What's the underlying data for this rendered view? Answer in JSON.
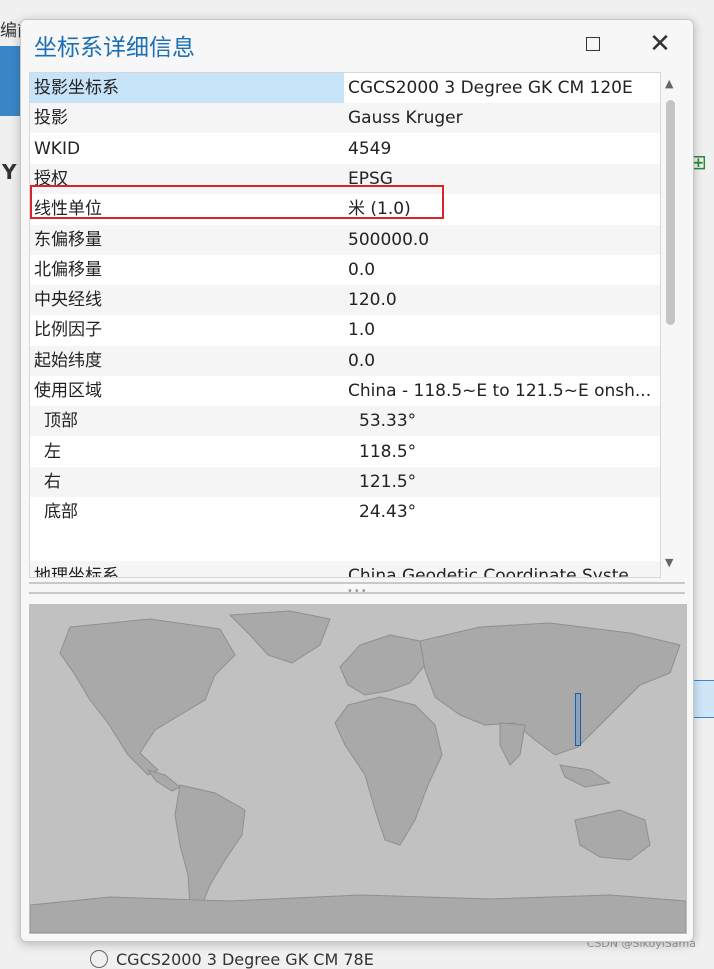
{
  "background": {
    "top_left_fragment": "编前",
    "left_fragment": "Y",
    "bottom_item": "CGCS2000 3 Degree GK CM 78E",
    "watermark": "CSDN @SikoyiSama"
  },
  "dialog": {
    "title": "坐标系详细信息",
    "maximize_icon": "maximize-icon",
    "close_icon": "close-icon"
  },
  "properties": [
    {
      "key": "投影坐标系",
      "value": "CGCS2000 3 Degree GK CM 120E",
      "selected": true
    },
    {
      "key": "投影",
      "value": "Gauss Kruger"
    },
    {
      "key": "WKID",
      "value": "4549",
      "highlighted": true
    },
    {
      "key": "授权",
      "value": "EPSG"
    },
    {
      "key": "线性单位",
      "value": "米 (1.0)"
    },
    {
      "key": "东偏移量",
      "value": "500000.0"
    },
    {
      "key": "北偏移量",
      "value": "0.0"
    },
    {
      "key": "中央经线",
      "value": "120.0"
    },
    {
      "key": "比例因子",
      "value": "1.0"
    },
    {
      "key": "起始纬度",
      "value": "0.0"
    },
    {
      "key": "使用区域",
      "value": "China - 118.5~E to 121.5~E onsh..."
    },
    {
      "key": "顶部",
      "value": "53.33°",
      "sub": true
    },
    {
      "key": "左",
      "value": "118.5°",
      "sub": true
    },
    {
      "key": "右",
      "value": "121.5°",
      "sub": true
    },
    {
      "key": "底部",
      "value": "24.43°",
      "sub": true
    },
    {
      "key": "地理坐标系",
      "value": "China Geodetic Coordinate Syste..."
    }
  ],
  "icons": {
    "scroll_up": "▲",
    "scroll_down": "▼",
    "splitter_grip": "•••"
  },
  "colors": {
    "title": "#1a6fb5",
    "selected_row": "#c6e3f7",
    "highlight_box": "#d9232d",
    "extent_box": "#1a5fa0"
  }
}
